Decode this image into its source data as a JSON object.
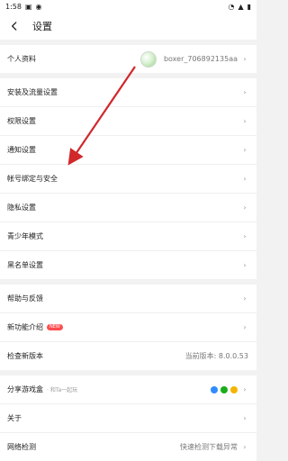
{
  "status_bar": {
    "time": "1:58"
  },
  "header": {
    "title": "设置"
  },
  "sections": [
    {
      "rows": [
        {
          "label": "个人资料",
          "value": "boxer_706892135aa"
        }
      ]
    },
    {
      "rows": [
        {
          "label": "安装及流量设置"
        },
        {
          "label": "权限设置"
        },
        {
          "label": "通知设置"
        },
        {
          "label": "帐号绑定与安全"
        },
        {
          "label": "隐私设置"
        },
        {
          "label": "青少年模式"
        },
        {
          "label": "黑名单设置"
        }
      ]
    },
    {
      "rows": [
        {
          "label": "帮助与反馈"
        },
        {
          "label": "新功能介绍",
          "badge": "NEW"
        },
        {
          "label": "检查新版本",
          "value": "当前版本: 8.0.0.53"
        }
      ]
    },
    {
      "rows": [
        {
          "label": "分享游戏盒",
          "sub": "· 和Ta一起玩"
        },
        {
          "label": "关于"
        },
        {
          "label": "网络检测",
          "value": "快速检测下载异常"
        }
      ]
    }
  ],
  "colors": {
    "arrow": "#d0282b"
  }
}
